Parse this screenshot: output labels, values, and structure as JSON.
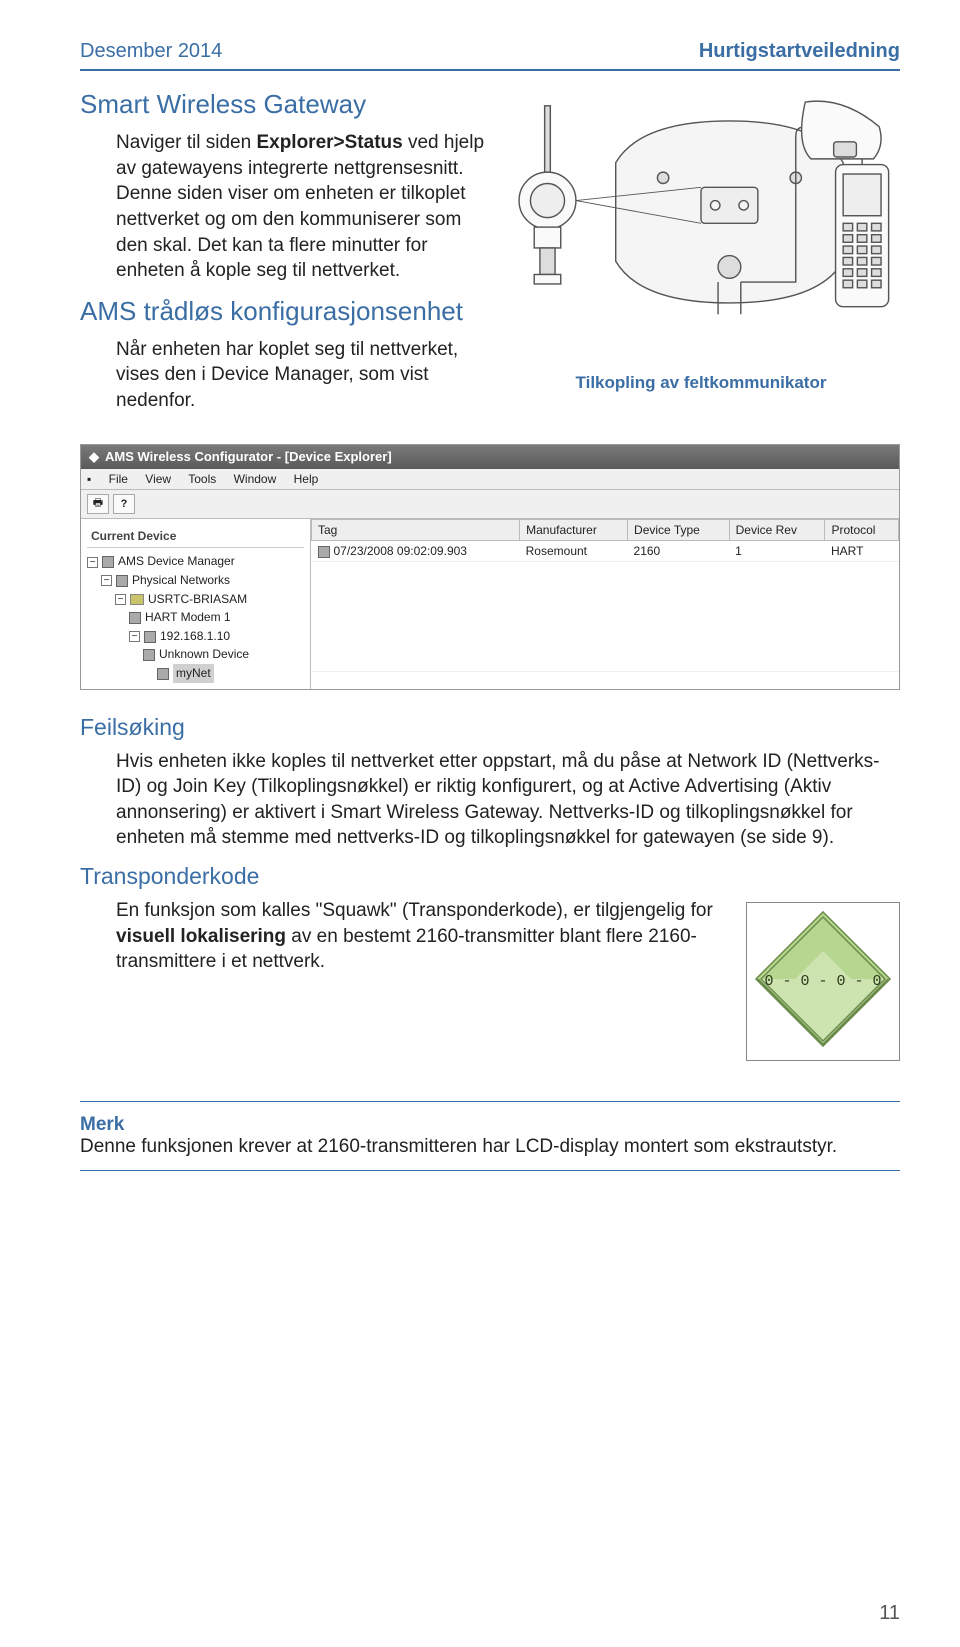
{
  "header": {
    "left": "Desember 2014",
    "right": "Hurtigstartveiledning"
  },
  "s1": {
    "title": "Smart Wireless Gateway",
    "p": "Naviger til siden <b>Explorer>Status</b> ved hjelp av gatewayens integrerte nettgrensesnitt. Denne siden viser om enheten er tilkoplet nettverket og om den kommuniserer som den skal. Det kan ta flere minutter for enheten å kople seg til nettverket."
  },
  "s2": {
    "title": "AMS trådløs konfigurasjonsenhet",
    "p": "Når enheten har koplet seg til nettverket, vises den i Device Manager, som vist nedenfor."
  },
  "caption": "Tilkopling av feltkommunikator",
  "screenshot": {
    "title": "AMS Wireless Configurator - [Device Explorer]",
    "menu": [
      "File",
      "View",
      "Tools",
      "Window",
      "Help"
    ],
    "tree_header": "Current Device",
    "tree": {
      "root": "AMS Device Manager",
      "n1": "Physical Networks",
      "n2": "USRTC-BRIASAM",
      "n3": "HART Modem 1",
      "n4": "192.168.1.10",
      "n5": "Unknown Device",
      "n6": "myNet"
    },
    "cols": [
      "Tag",
      "Manufacturer",
      "Device Type",
      "Device Rev",
      "Protocol"
    ],
    "row": {
      "tag": "07/23/2008 09:02:09.903",
      "manufacturer": "Rosemount",
      "device_type": "2160",
      "device_rev": "1",
      "protocol": "HART"
    }
  },
  "s3": {
    "title": "Feilsøking",
    "p": "Hvis enheten ikke koples til nettverket etter oppstart, må du påse at Network ID (Nettverks-ID) og Join Key (Tilkoplingsnøkkel) er riktig konfigurert, og at Active Advertising (Aktiv annonsering) er aktivert i Smart Wireless Gateway. Nettverks-ID og tilkoplingsnøkkel for enheten må stemme med nettverks-ID og tilkoplingsnøkkel for gatewayen (se side 9)."
  },
  "s4": {
    "title": "Transponderkode",
    "p": "En funksjon som kalles \"Squawk\" (Transponderkode), er tilgjengelig for <b>visuell lokalisering</b> av en bestemt 2160-transmitter blant flere 2160-transmittere i et nettverk.",
    "diamond_text": "0 - 0 - 0 - 0"
  },
  "note": {
    "label": "Merk",
    "text": "Denne funksjonen krever at 2160-transmitteren har LCD-display montert som ekstrautstyr."
  },
  "page": "11"
}
